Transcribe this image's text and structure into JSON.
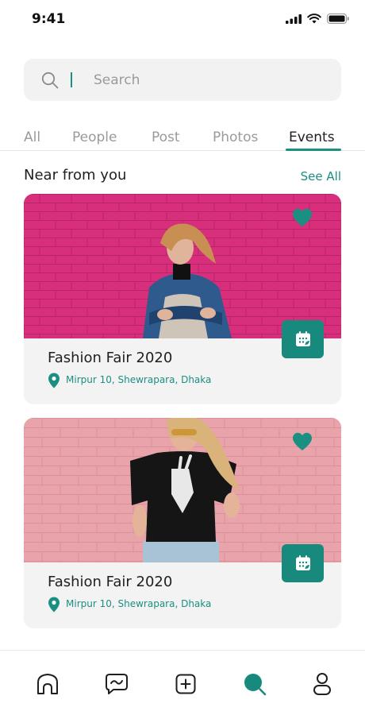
{
  "status_bar": {
    "time": "9:41"
  },
  "search": {
    "placeholder": "Search"
  },
  "tabs": [
    {
      "label": "All"
    },
    {
      "label": "People"
    },
    {
      "label": "Post"
    },
    {
      "label": "Photos"
    },
    {
      "label": "Events",
      "active": true
    }
  ],
  "section": {
    "title": "Near from you",
    "see_all": "See All"
  },
  "events": [
    {
      "title": "Fashion Fair 2020",
      "location": "Mirpur 10, Shewrapara, Dhaka"
    },
    {
      "title": "Fashion Fair 2020",
      "location": "Mirpur 10, Shewrapara, Dhaka"
    }
  ],
  "bottom_nav": [
    {
      "icon": "home-icon"
    },
    {
      "icon": "chat-icon"
    },
    {
      "icon": "add-icon"
    },
    {
      "icon": "search-icon",
      "active": true
    },
    {
      "icon": "profile-icon"
    }
  ],
  "colors": {
    "accent": "#178a7d",
    "card_bg": "#f3f3f3",
    "search_bg": "#f2f2f2"
  }
}
